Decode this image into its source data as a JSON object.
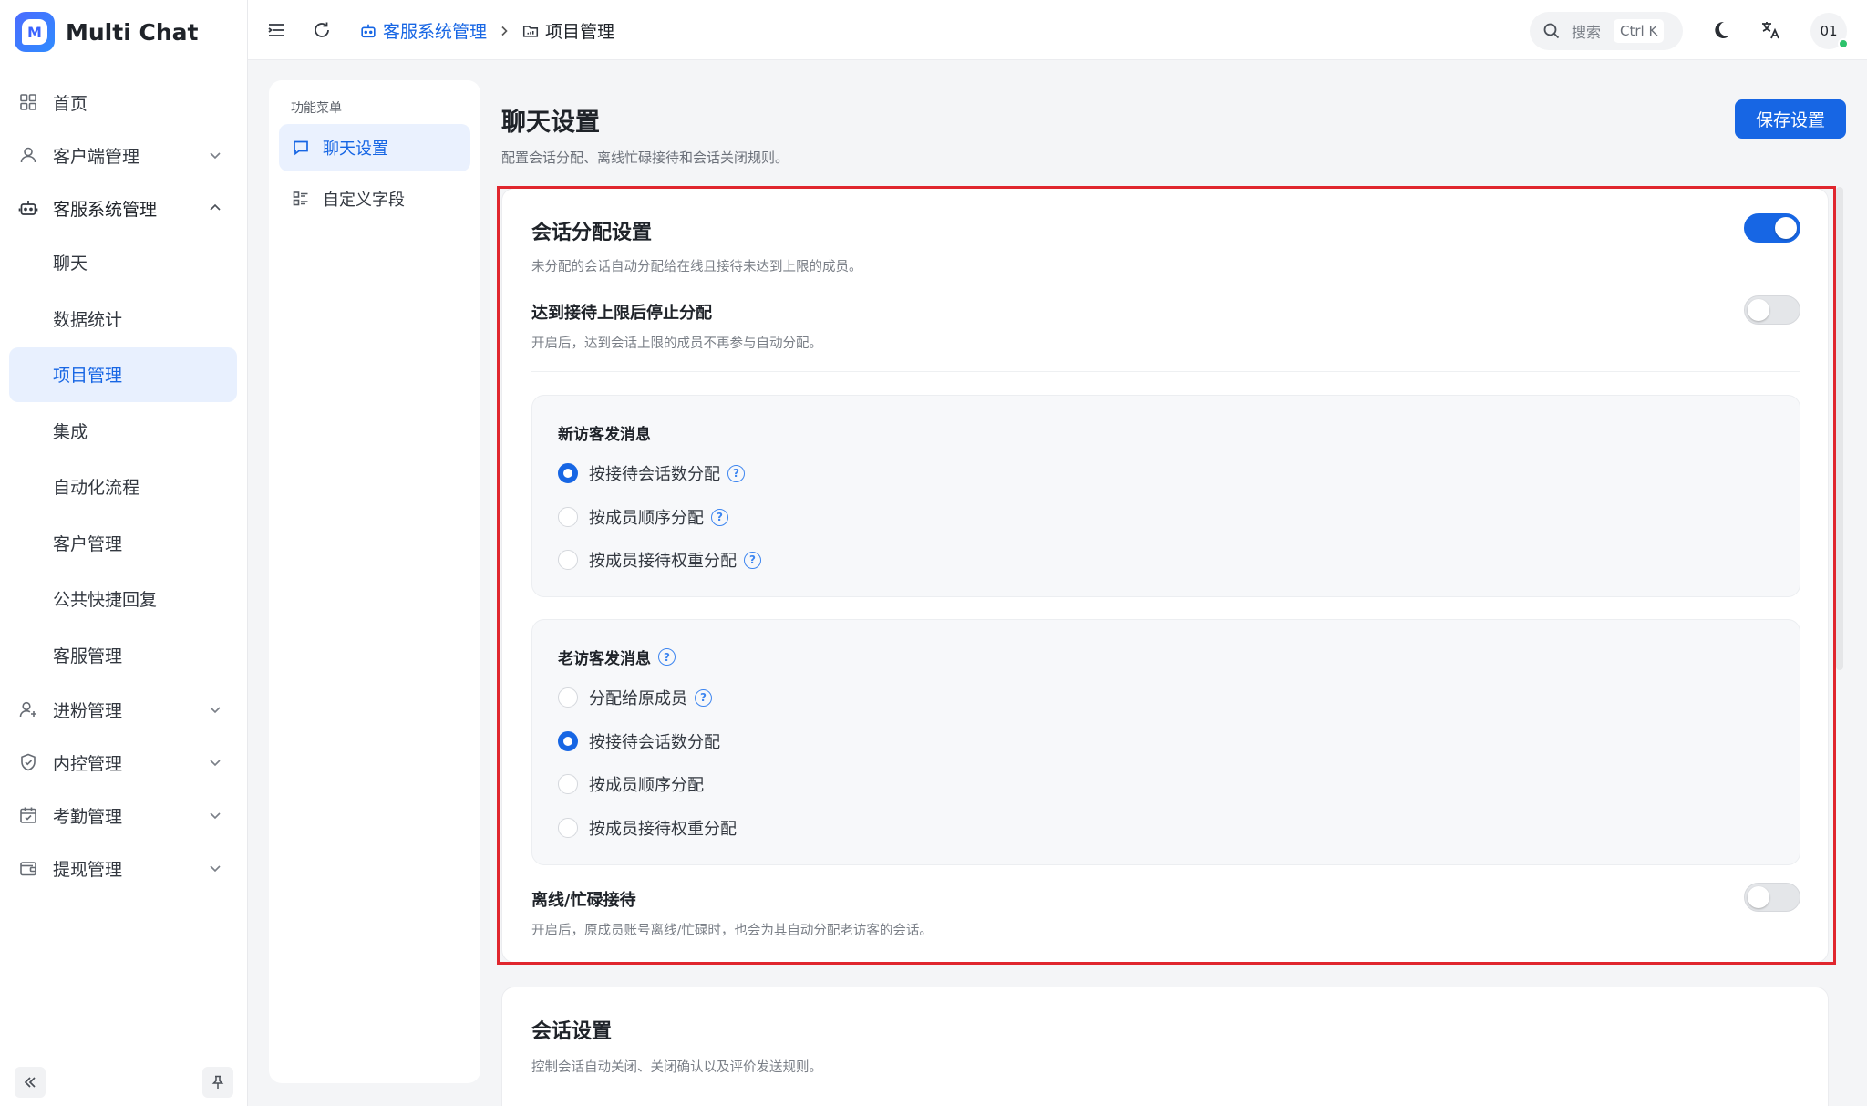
{
  "brand": {
    "name": "Multi Chat",
    "logo_letter": "M"
  },
  "sidebar": {
    "items": [
      {
        "label": "首页",
        "icon": "home-grid-icon"
      },
      {
        "label": "客户端管理",
        "icon": "user-icon"
      },
      {
        "label": "客服系统管理",
        "icon": "robot-icon",
        "expanded": true
      },
      {
        "label": "聊天"
      },
      {
        "label": "数据统计"
      },
      {
        "label": "项目管理",
        "active": true
      },
      {
        "label": "集成"
      },
      {
        "label": "自动化流程"
      },
      {
        "label": "客户管理"
      },
      {
        "label": "公共快捷回复"
      },
      {
        "label": "客服管理"
      },
      {
        "label": "进粉管理",
        "icon": "user-plus-icon"
      },
      {
        "label": "内控管理",
        "icon": "shield-icon"
      },
      {
        "label": "考勤管理",
        "icon": "calendar-check-icon"
      },
      {
        "label": "提现管理",
        "icon": "wallet-icon"
      }
    ]
  },
  "header": {
    "breadcrumb": [
      "客服系统管理",
      "项目管理"
    ],
    "search_placeholder": "搜索",
    "search_shortcut": "Ctrl K",
    "avatar_text": "01"
  },
  "func_menu": {
    "title": "功能菜单",
    "items": [
      {
        "label": "聊天设置",
        "active": true
      },
      {
        "label": "自定义字段"
      }
    ]
  },
  "main": {
    "title": "聊天设置",
    "subtitle": "配置会话分配、离线忙碌接待和会话关闭规则。",
    "save_label": "保存设置",
    "assign": {
      "title": "会话分配设置",
      "subtitle": "未分配的会话自动分配给在线且接待未达到上限的成员。",
      "enabled": true,
      "limit_title": "达到接待上限后停止分配",
      "limit_sub": "开启后，达到会话上限的成员不再参与自动分配。",
      "limit_enabled": false,
      "new_visitor": {
        "title": "新访客发消息",
        "options": [
          "按接待会话数分配",
          "按成员顺序分配",
          "按成员接待权重分配"
        ],
        "selected": 0
      },
      "old_visitor": {
        "title": "老访客发消息",
        "options": [
          "分配给原成员",
          "按接待会话数分配",
          "按成员顺序分配",
          "按成员接待权重分配"
        ],
        "selected": 1
      },
      "offline_title": "离线/忙碌接待",
      "offline_sub": "开启后，原成员账号离线/忙碌时，也会为其自动分配老访客的会话。",
      "offline_enabled": false
    },
    "session": {
      "title": "会话设置",
      "subtitle": "控制会话自动关闭、关闭确认以及评价发送规则。"
    }
  },
  "colors": {
    "accent": "#1766e4",
    "highlight": "#e0262e"
  }
}
